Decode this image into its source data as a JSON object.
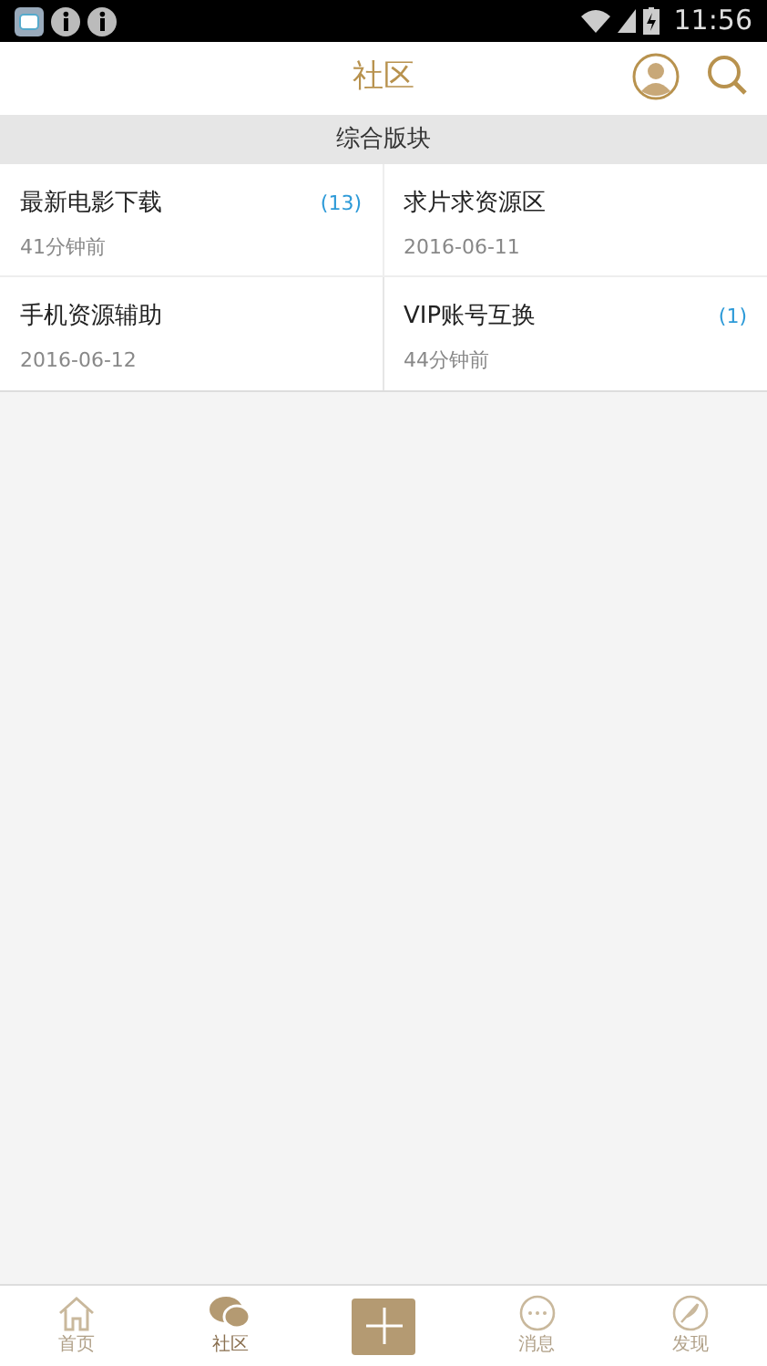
{
  "status_bar": {
    "time": "11:56"
  },
  "header": {
    "title": "社区"
  },
  "section": {
    "title": "综合版块"
  },
  "forums": [
    {
      "name": "最新电影下载",
      "time": "41分钟前",
      "count": "(13)"
    },
    {
      "name": "求片求资源区",
      "time": "2016-06-11"
    },
    {
      "name": "手机资源辅助",
      "time": "2016-06-12"
    },
    {
      "name": "VIP账号互换",
      "time": "44分钟前",
      "count": "(1)"
    }
  ],
  "tab_bar": [
    {
      "kind": "home",
      "label": "首页",
      "selected": false
    },
    {
      "kind": "community",
      "label": "社区",
      "selected": true
    },
    {
      "kind": "add"
    },
    {
      "kind": "messages",
      "label": "消息",
      "selected": false
    },
    {
      "kind": "discover",
      "label": "发现",
      "selected": false
    }
  ]
}
